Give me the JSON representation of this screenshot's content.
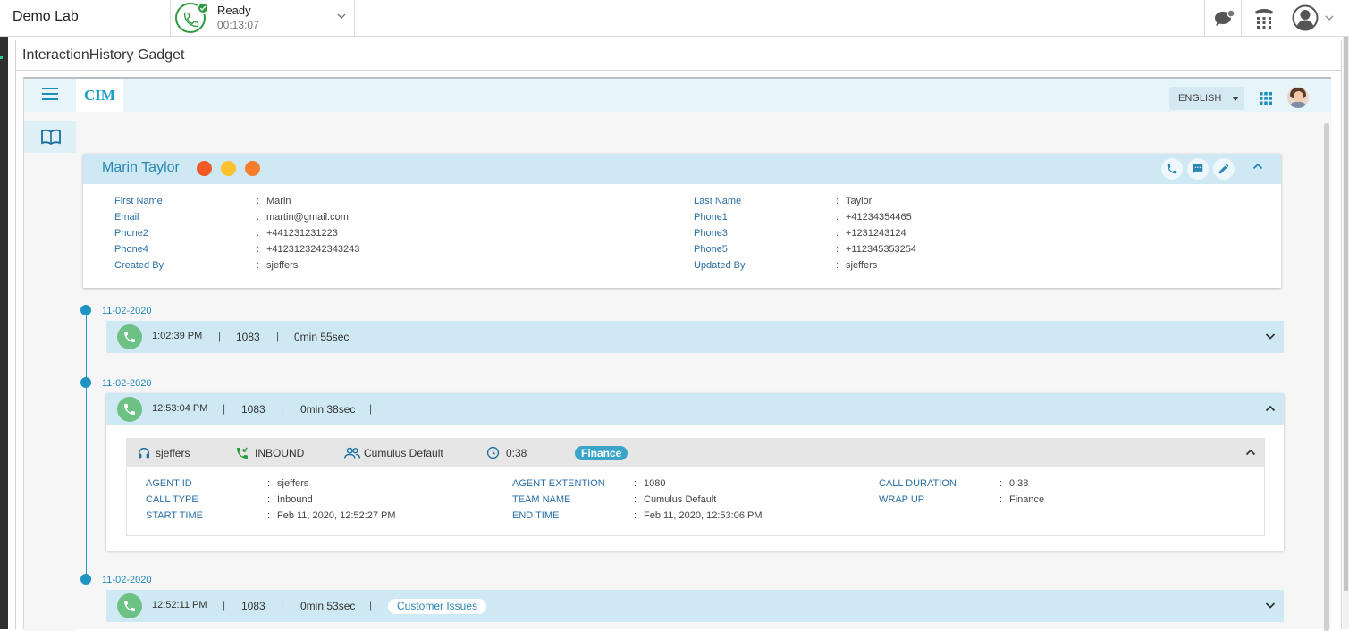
{
  "topbar": {
    "brand": "Demo Lab",
    "agent_state": {
      "label": "Ready",
      "timer": "00:13:07"
    },
    "icons": [
      "chat-icon",
      "dialpad-icon",
      "user-profile-icon"
    ]
  },
  "gadget": {
    "title": "InteractionHistory Gadget"
  },
  "app": {
    "logo": "CIM",
    "language": "ENGLISH"
  },
  "customer": {
    "name": "Marin Taylor",
    "dot_colors": [
      "#f15a24",
      "#fbc02d",
      "#f57c2b"
    ],
    "left_fields": [
      {
        "label": "First Name",
        "value": "Marin"
      },
      {
        "label": "Email",
        "value": "martin@gmail.com"
      },
      {
        "label": "Phone2",
        "value": "+441231231223"
      },
      {
        "label": "Phone4",
        "value": "+4123123242343243"
      },
      {
        "label": "Created By",
        "value": "sjeffers"
      }
    ],
    "right_fields": [
      {
        "label": "Last Name",
        "value": "Taylor"
      },
      {
        "label": "Phone1",
        "value": "+41234354465"
      },
      {
        "label": "Phone3",
        "value": "+1231243124"
      },
      {
        "label": "Phone5",
        "value": "+112345353254"
      },
      {
        "label": "Updated By",
        "value": "sjeffers"
      }
    ],
    "colon": ":"
  },
  "interactions": [
    {
      "date": "11-02-2020",
      "time": "1:02:39 PM",
      "ext": "1083",
      "duration": "0min 55sec",
      "sep": "|"
    },
    {
      "date": "11-02-2020",
      "time": "12:53:04 PM",
      "ext": "1083",
      "duration": "0min 38sec",
      "sep": "|",
      "detail": {
        "agent": "sjeffers",
        "direction": "INBOUND",
        "team": "Cumulus Default",
        "duration": "0:38",
        "wrapup_badge": "Finance",
        "fields": [
          {
            "label": "AGENT ID",
            "value": "sjeffers"
          },
          {
            "label": "CALL TYPE",
            "value": "Inbound"
          },
          {
            "label": "START TIME",
            "value": "Feb 11, 2020, 12:52:27 PM"
          },
          {
            "label": "AGENT EXTENTION",
            "value": "1080"
          },
          {
            "label": "TEAM NAME",
            "value": "Cumulus Default"
          },
          {
            "label": "END TIME",
            "value": "Feb 11, 2020, 12:53:06 PM"
          },
          {
            "label": "CALL DURATION",
            "value": "0:38"
          },
          {
            "label": "WRAP UP",
            "value": "Finance"
          }
        ]
      }
    },
    {
      "date": "11-02-2020",
      "time": "12:52:11 PM",
      "ext": "1083",
      "duration": "0min 53sec",
      "sep": "|",
      "tag": "Customer Issues"
    }
  ],
  "colors": {
    "accent": "#1f9bc7",
    "header_bg": "#cfe9f4",
    "call_green": "#6ec185",
    "ready_green": "#2e9a3e"
  }
}
